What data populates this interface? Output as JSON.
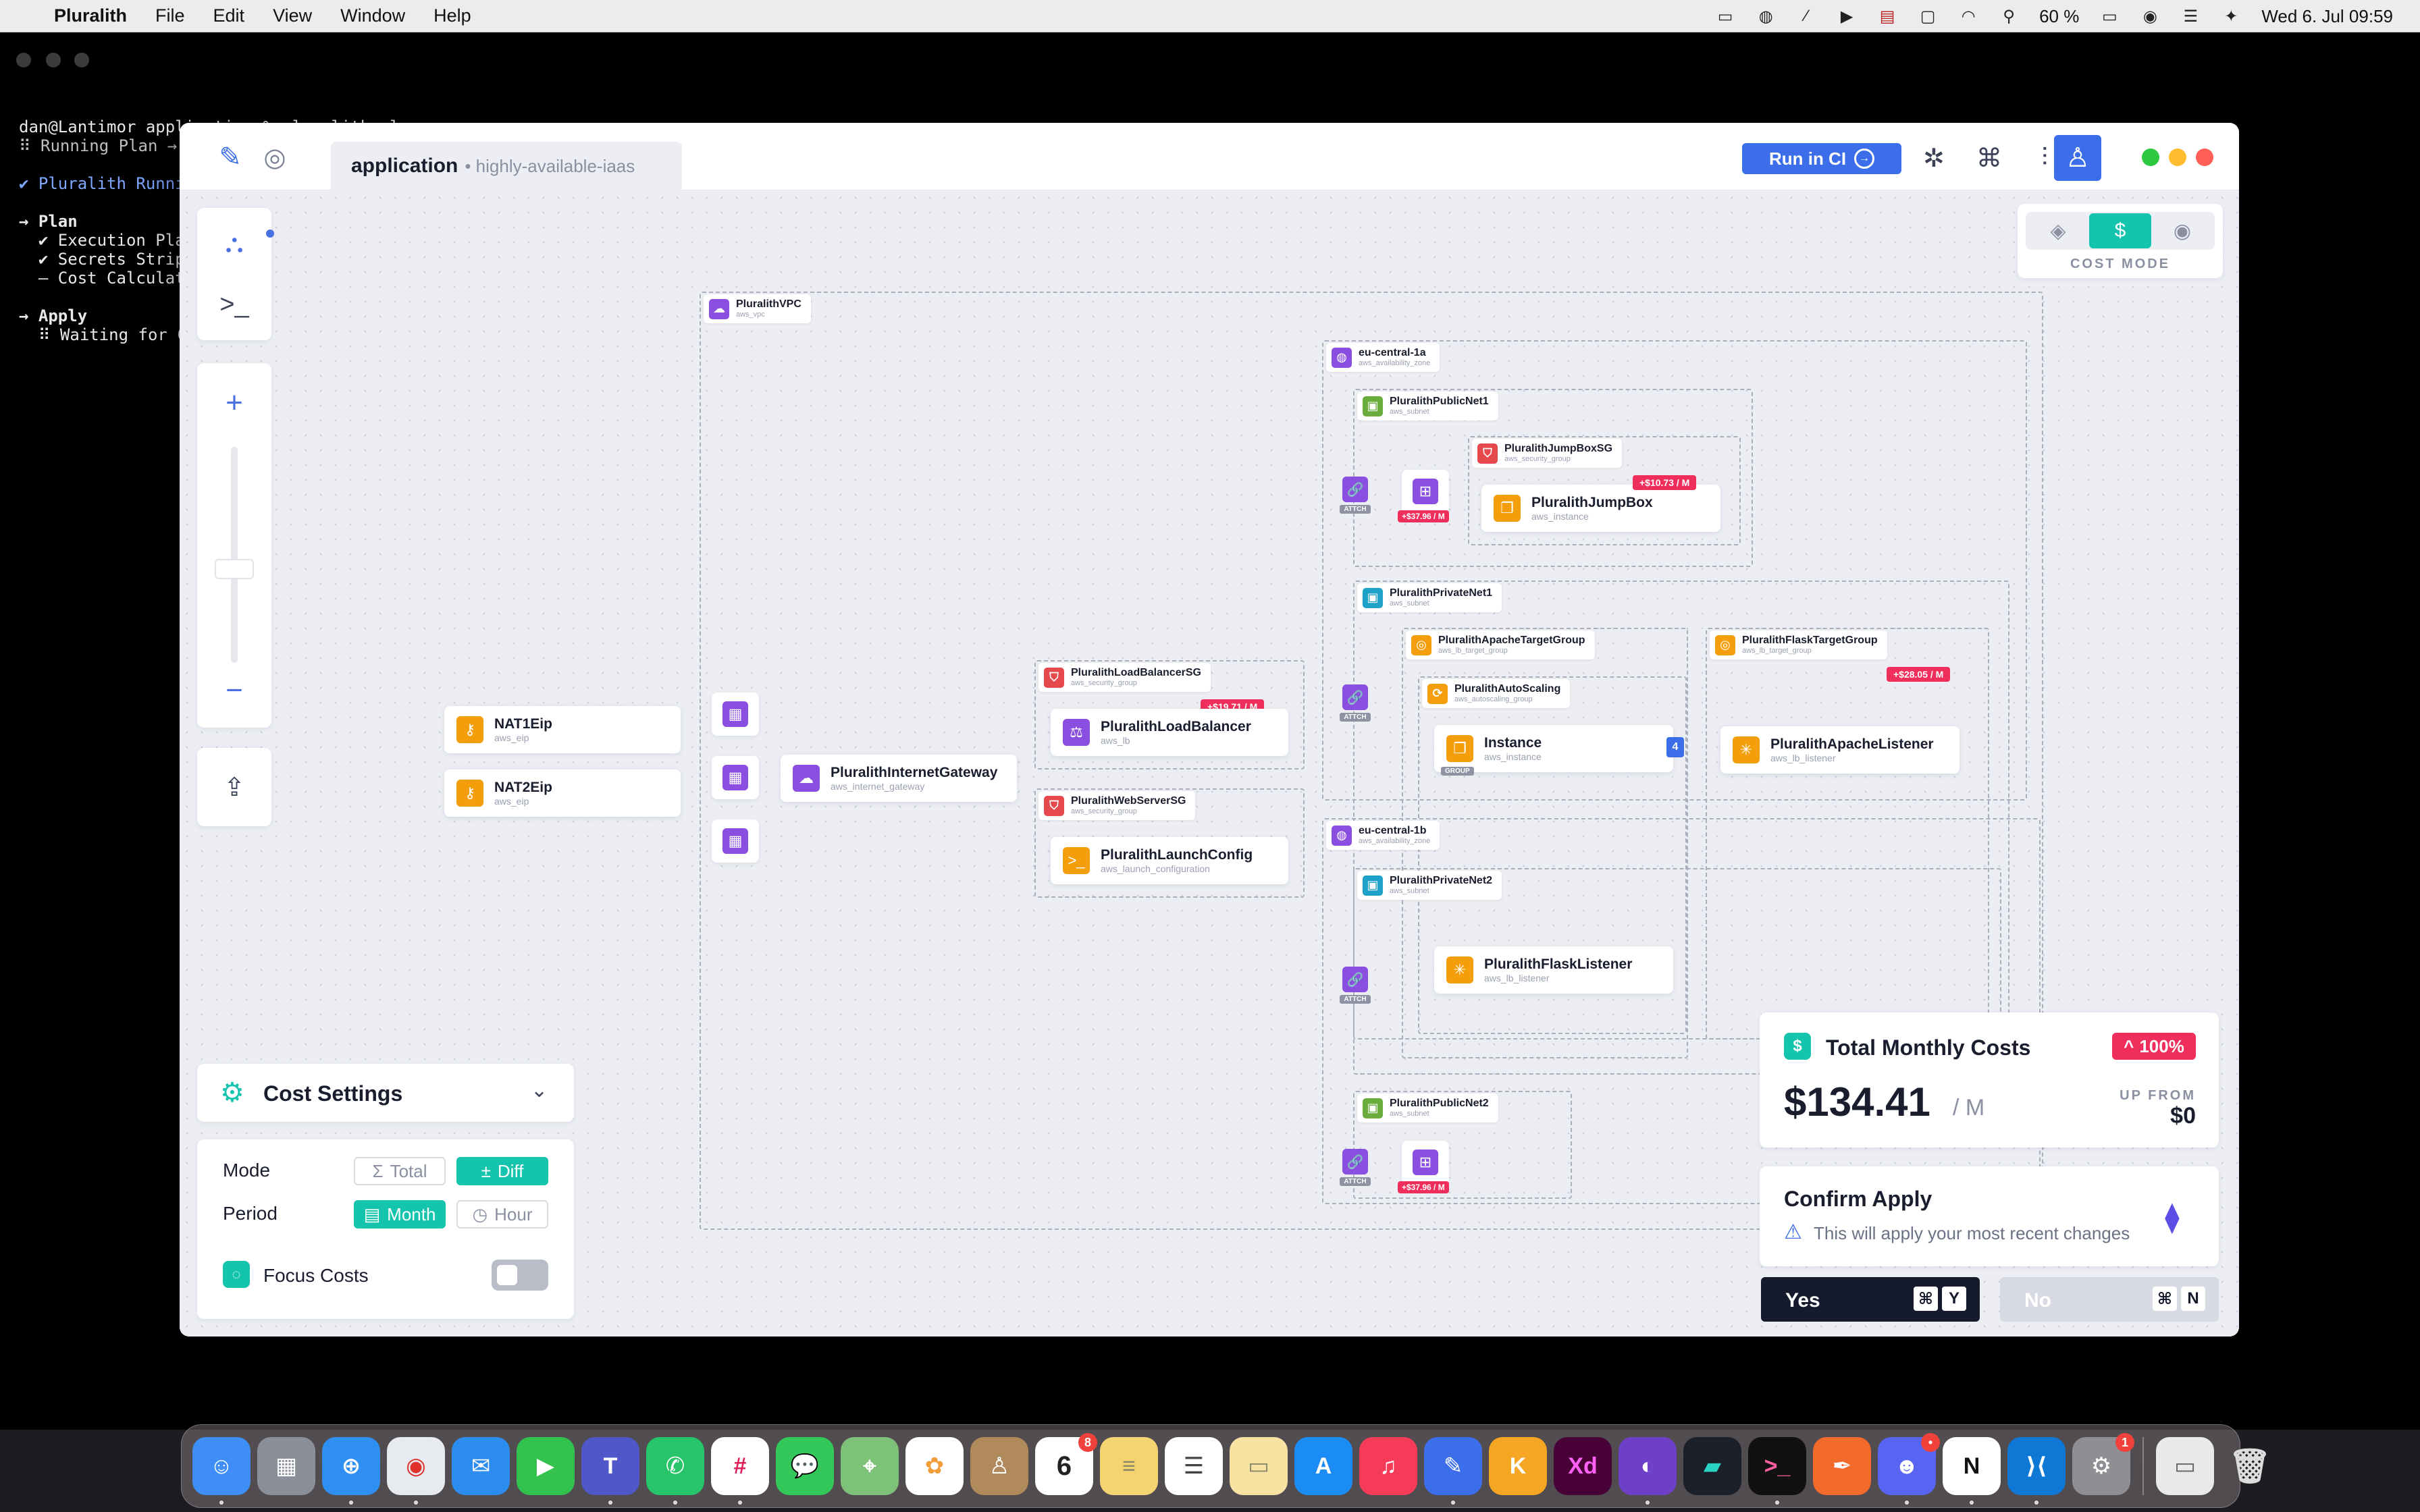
{
  "menubar": {
    "app_name": "Pluralith",
    "items": [
      "File",
      "Edit",
      "View",
      "Window",
      "Help"
    ],
    "battery": "60 %",
    "datetime": "Wed 6. Jul  09:59"
  },
  "terminal": {
    "lines": [
      "dan@Lantimor application % pluralith plan",
      "⠿ Running Plan →",
      "",
      "✔ Pluralith Runni",
      "",
      "→ Plan",
      "  ✔ Execution Pla",
      "  ✔ Secrets Strip",
      "  – Cost Calculat",
      "",
      "→ Apply",
      "  ⠿ Waiting for C"
    ]
  },
  "window": {
    "tab_title": "application",
    "tab_subtitle": "• highly-available-iaas",
    "run_ci_label": "Run in CI",
    "cost_mode_label": "COST MODE"
  },
  "graph": {
    "vpc": {
      "name": "PluralithVPC",
      "type": "aws_vpc"
    },
    "az1": {
      "name": "eu-central-1a",
      "type": "aws_availability_zone"
    },
    "az2": {
      "name": "eu-central-1b",
      "type": "aws_availability_zone"
    },
    "public_net1": {
      "name": "PluralithPublicNet1",
      "type": "aws_subnet"
    },
    "public_net2": {
      "name": "PluralithPublicNet2",
      "type": "aws_subnet"
    },
    "private_net1": {
      "name": "PluralithPrivateNet1",
      "type": "aws_subnet"
    },
    "private_net2": {
      "name": "PluralithPrivateNet2",
      "type": "aws_subnet"
    },
    "jumpbox_sg": {
      "name": "PluralithJumpBoxSG",
      "type": "aws_security_group"
    },
    "lb_sg": {
      "name": "PluralithLoadBalancerSG",
      "type": "aws_security_group"
    },
    "web_sg": {
      "name": "PluralithWebServerSG",
      "type": "aws_security_group"
    },
    "apache_tg": {
      "name": "PluralithApacheTargetGroup",
      "type": "aws_lb_target_group"
    },
    "flask_tg": {
      "name": "PluralithFlaskTargetGroup",
      "type": "aws_lb_target_group"
    },
    "autoscaling": {
      "name": "PluralithAutoScaling",
      "type": "aws_autoscaling_group"
    },
    "nat1": {
      "name": "NAT1Eip",
      "type": "aws_eip"
    },
    "nat2": {
      "name": "NAT2Eip",
      "type": "aws_eip"
    },
    "igw": {
      "name": "PluralithInternetGateway",
      "type": "aws_internet_gateway"
    },
    "lb": {
      "name": "PluralithLoadBalancer",
      "type": "aws_lb"
    },
    "launch": {
      "name": "PluralithLaunchConfig",
      "type": "aws_launch_configuration"
    },
    "jumpbox": {
      "name": "PluralithJumpBox",
      "type": "aws_instance"
    },
    "instance": {
      "name": "Instance",
      "type": "aws_instance",
      "count": "4",
      "group_label": "GROUP"
    },
    "apache_listener": {
      "name": "PluralithApacheListener",
      "type": "aws_lb_listener"
    },
    "flask_listener": {
      "name": "PluralithFlaskListener",
      "type": "aws_lb_listener"
    },
    "attach_label": "ATTCH",
    "costs": {
      "jumpbox": "+$10.73 / M",
      "nat_public1": "+$37.96 / M",
      "lb": "+$19.71 / M",
      "flask_tg": "+$28.05 / M",
      "nat_public2": "+$37.96 / M"
    }
  },
  "cost_settings": {
    "title": "Cost Settings",
    "mode_label": "Mode",
    "period_label": "Period",
    "focus_label": "Focus Costs",
    "mode_options": [
      "Total",
      "Diff"
    ],
    "period_options": [
      "Month",
      "Hour"
    ],
    "selected_mode": "Diff",
    "selected_period": "Month",
    "focus_enabled": false
  },
  "total_costs": {
    "title": "Total Monthly Costs",
    "change": "100%",
    "amount": "$134.41",
    "unit": "/ M",
    "up_from_label": "UP FROM",
    "up_from_value": "$0"
  },
  "confirm": {
    "title": "Confirm Apply",
    "message": "This will apply your most recent changes",
    "yes_label": "Yes",
    "yes_key": "Y",
    "no_label": "No",
    "no_key": "N",
    "cmd_symbol": "⌘"
  },
  "colors": {
    "accent_teal": "#14c4ad",
    "accent_blue": "#3b6ee8",
    "cost_red": "#ef2e5b",
    "resource_purple": "#8a4fe0",
    "resource_orange": "#f59e0b",
    "subnet_green": "#6aad3d",
    "sg_red": "#e5484d"
  }
}
